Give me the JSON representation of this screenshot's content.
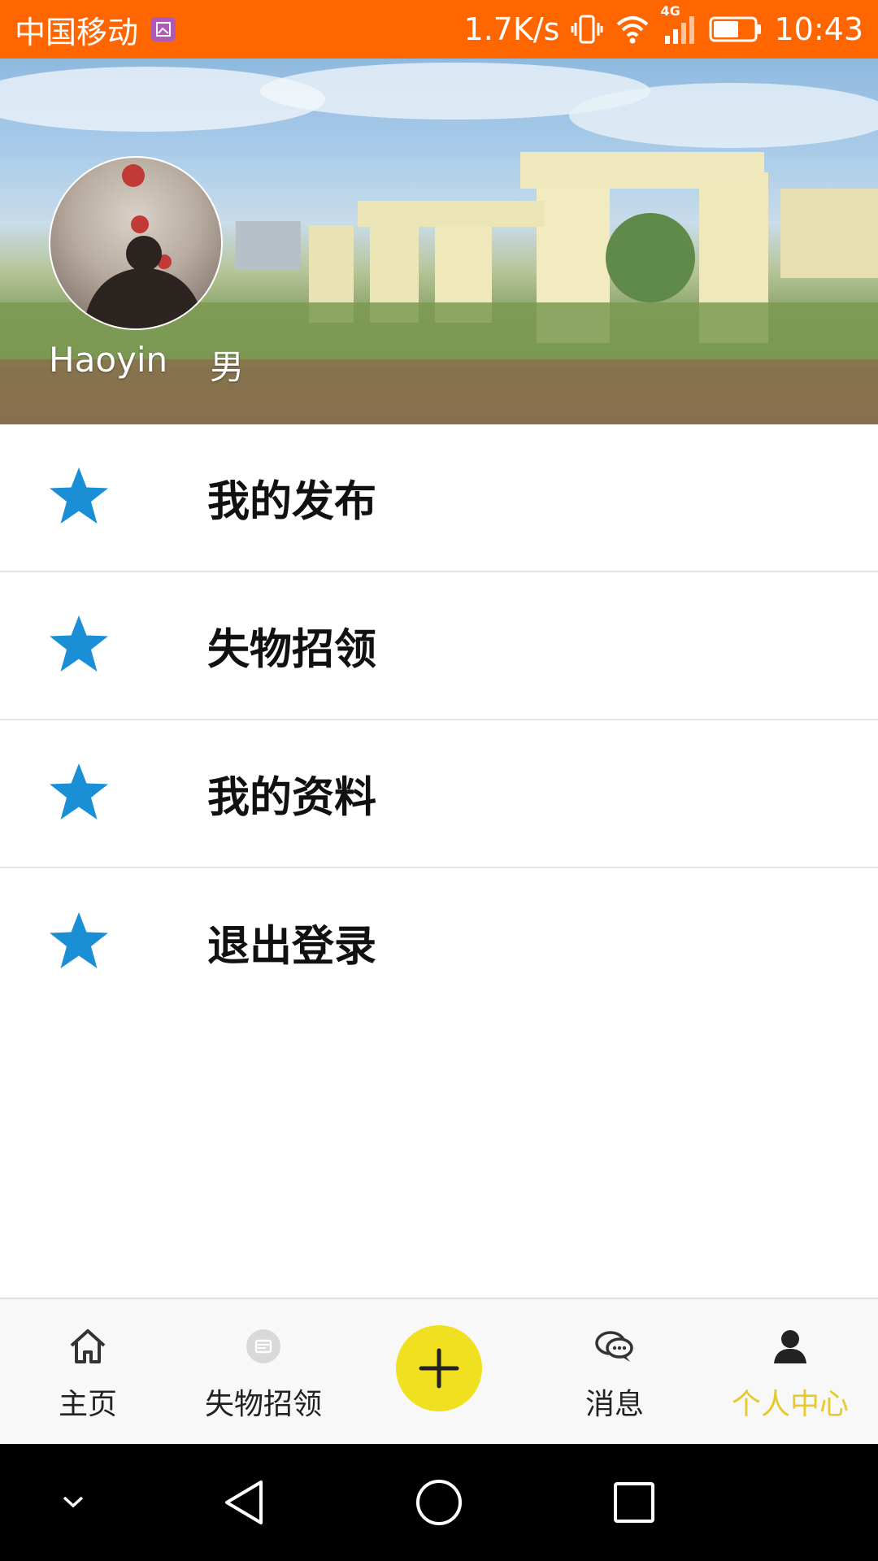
{
  "status_bar": {
    "carrier": "中国移动",
    "speed": "1.7K/s",
    "network": "4G",
    "time": "10:43",
    "background_color": "#ff6600"
  },
  "profile": {
    "name": "Haoyin",
    "gender": "男"
  },
  "menu": {
    "items": [
      {
        "label": "我的发布",
        "icon": "star-icon"
      },
      {
        "label": "失物招领",
        "icon": "star-icon"
      },
      {
        "label": "我的资料",
        "icon": "star-icon"
      },
      {
        "label": "退出登录",
        "icon": "star-icon"
      }
    ],
    "icon_color": "#1a8fd6"
  },
  "tabbar": {
    "tabs": [
      {
        "label": "主页",
        "icon": "home-icon"
      },
      {
        "label": "失物招领",
        "icon": "lost-found-icon"
      },
      {
        "label": "消息",
        "icon": "message-icon"
      },
      {
        "label": "个人中心",
        "icon": "person-icon"
      }
    ],
    "add_icon": "plus-icon",
    "active_color": "#e6c92a",
    "add_button_color": "#f0e020"
  },
  "navbar": {
    "buttons": [
      "chevron-down-icon",
      "back-icon",
      "home-circle-icon",
      "recents-icon"
    ]
  }
}
